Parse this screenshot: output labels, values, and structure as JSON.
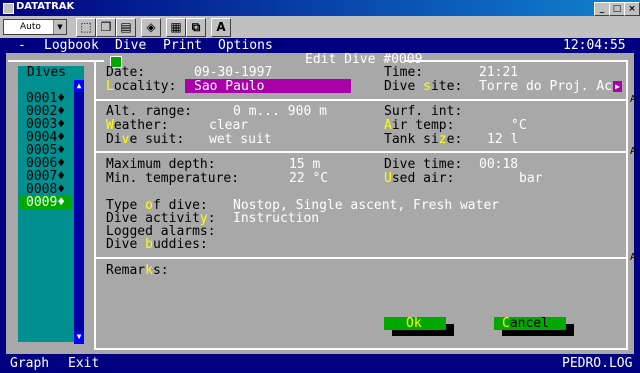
{
  "window": {
    "title": "DATATRAK"
  },
  "toolbar": {
    "font_size": "Auto",
    "bold_icon": "A"
  },
  "menu": {
    "dash": "-",
    "items": [
      "Logbook",
      "Dive",
      "Print",
      "Options"
    ],
    "clock": "12:04:55"
  },
  "dialog": {
    "title": "Edit Dive #0009"
  },
  "dives": {
    "header": "Dives",
    "items": [
      "0001♦",
      "0002♦",
      "0003♦",
      "0004♦",
      "0005♦",
      "0006♦",
      "0007♦",
      "0008♦",
      "0009♦"
    ],
    "selected": 8
  },
  "general": {
    "date_label": "Date:",
    "date_value": "09-30-1997",
    "locality_label": "Locality:",
    "locality_value": "Sao Paulo",
    "time_label": "Time:",
    "time_value": "21:21",
    "site_label": "Dive site:",
    "site_value": "Torre do Proj. Ac"
  },
  "conditions": {
    "alt_label": "Alt. range:",
    "alt_value": "0 m... 900 m",
    "surf_label": "Surf. int:",
    "weather_label": "Weather:",
    "weather_value": "clear",
    "airtemp_label": "Air temp:",
    "airtemp_value": "°C",
    "suit_label": "Dive suit:",
    "suit_value": "wet suit",
    "tank_label": "Tank size:",
    "tank_value": "12 l"
  },
  "profile": {
    "maxdepth_label": "Maximum depth:",
    "maxdepth_value": "15 m",
    "mintemp_label": "Min. temperature:",
    "mintemp_value": "22 °C",
    "divetime_label": "Dive time:",
    "divetime_value": "00:18",
    "usedair_label": "Used air:",
    "usedair_value": "bar",
    "type_label": "Type of dive:",
    "type_value": "Nostop, Single ascent, Fresh water",
    "activity_label": "Dive activity:",
    "activity_value": "Instruction",
    "alarms_label": "Logged alarms:",
    "buddies_label": "Dive buddies:"
  },
  "remarks": {
    "label": "Remarks:"
  },
  "buttons": {
    "ok": "Ok",
    "cancel": "Cancel"
  },
  "status": {
    "graph": "Graph",
    "exit": "Exit",
    "file": "PEDRO.LOG"
  },
  "colors": {
    "dos_blue": "#000080",
    "panel_gray": "#a8a8a8",
    "dive_teal": "#009090",
    "highlight_yellow": "#ffff00",
    "field_magenta": "#a800a8",
    "button_green": "#00a800"
  }
}
